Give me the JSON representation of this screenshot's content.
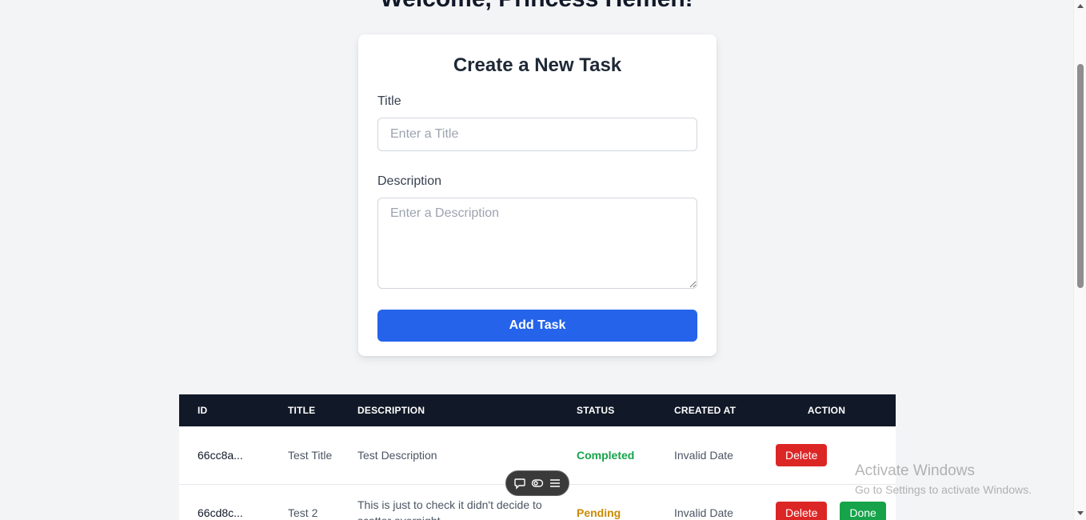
{
  "welcome": "Welcome, Princess Hemen!",
  "form": {
    "heading": "Create a New Task",
    "title_label": "Title",
    "title_placeholder": "Enter a Title",
    "title_value": "",
    "description_label": "Description",
    "description_placeholder": "Enter a Description",
    "description_value": "",
    "submit_label": "Add Task"
  },
  "table": {
    "headers": [
      "ID",
      "TITLE",
      "DESCRIPTION",
      "STATUS",
      "CREATED AT",
      "ACTION"
    ],
    "rows": [
      {
        "id": "66cc8a...",
        "title": "Test Title",
        "description": "Test Description",
        "status": "Completed",
        "created_at": "Invalid Date",
        "delete_label": "Delete"
      },
      {
        "id": "66cd8c...",
        "title": "Test 2",
        "description": "This is just to check it didn't decide to scatter overnight",
        "status": "Pending",
        "created_at": "Invalid Date",
        "delete_label": "Delete",
        "done_label": "Done"
      }
    ]
  },
  "toolbar_pill": {
    "icons": [
      "comment-icon",
      "toggle-icon",
      "menu-icon"
    ]
  },
  "watermark": {
    "line1": "Activate Windows",
    "line2": "Go to Settings to activate Windows."
  },
  "colors": {
    "primary": "#2563eb",
    "header_bg": "#111827",
    "delete": "#dc2626",
    "done": "#16a34a",
    "completed": "#16a34a",
    "pending": "#ca8a04"
  }
}
